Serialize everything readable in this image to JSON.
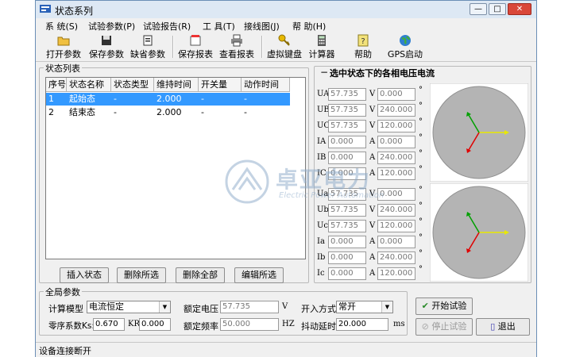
{
  "window": {
    "title": "状态系列",
    "minimize": "—",
    "maximize": "□",
    "close": "✕"
  },
  "menu": [
    "系 统(S)",
    "试验参数(P)",
    "试验报告(R)",
    "工 具(T)",
    "接线图(J)",
    "帮 助(H)"
  ],
  "toolbar": [
    {
      "label": "打开参数",
      "icon": "open-folder-icon"
    },
    {
      "label": "保存参数",
      "icon": "floppy-disk-icon"
    },
    {
      "label": "缺省参数",
      "icon": "default-doc-icon"
    },
    {
      "label": "保存报表",
      "icon": "save-report-icon"
    },
    {
      "label": "查看报表",
      "icon": "printer-icon"
    },
    {
      "label": "虚拟键盘",
      "icon": "key-icon"
    },
    {
      "label": "计算器",
      "icon": "calculator-icon"
    },
    {
      "label": "帮助",
      "icon": "help-icon"
    },
    {
      "label": "GPS启动",
      "icon": "globe-icon"
    }
  ],
  "state_list": {
    "title": "状态列表",
    "columns": [
      "序号",
      "状态名称",
      "状态类型",
      "维持时间",
      "开关量",
      "动作时间"
    ],
    "rows": [
      [
        "1",
        "起始态",
        "-",
        "2.000",
        "-",
        "-"
      ],
      [
        "2",
        "结束态",
        "-",
        "2.000",
        "-",
        "-"
      ]
    ],
    "buttons": [
      "插入状态",
      "删除所选",
      "删除全部",
      "编辑所选"
    ]
  },
  "phase_panel": {
    "title": "选中状态下的各相电压电流",
    "collapse_glyph": "−",
    "group1": [
      {
        "label": "UA",
        "mag": "57.735",
        "unit": "V",
        "angle": "0.000"
      },
      {
        "label": "UB",
        "mag": "57.735",
        "unit": "V",
        "angle": "240.000"
      },
      {
        "label": "UC",
        "mag": "57.735",
        "unit": "V",
        "angle": "120.000"
      },
      {
        "label": "IA",
        "mag": "0.000",
        "unit": "A",
        "angle": "0.000"
      },
      {
        "label": "IB",
        "mag": "0.000",
        "unit": "A",
        "angle": "240.000"
      },
      {
        "label": "IC",
        "mag": "0.000",
        "unit": "A",
        "angle": "120.000"
      }
    ],
    "group2": [
      {
        "label": "Ua",
        "mag": "57.735",
        "unit": "V",
        "angle": "0.000"
      },
      {
        "label": "Ub",
        "mag": "57.735",
        "unit": "V",
        "angle": "240.000"
      },
      {
        "label": "Uc",
        "mag": "57.735",
        "unit": "V",
        "angle": "120.000"
      },
      {
        "label": "Ia",
        "mag": "0.000",
        "unit": "A",
        "angle": "0.000"
      },
      {
        "label": "Ib",
        "mag": "0.000",
        "unit": "A",
        "angle": "240.000"
      },
      {
        "label": "Ic",
        "mag": "0.000",
        "unit": "A",
        "angle": "120.000"
      }
    ],
    "degree_symbol": "°"
  },
  "global": {
    "title": "全局参数",
    "calc_model_label": "计算模型",
    "calc_model_value": "电流恒定",
    "rated_voltage_label": "额定电压",
    "rated_voltage_value": "57.735",
    "rated_voltage_unit": "V",
    "input_mode_label": "开入方式",
    "input_mode_value": "常开",
    "zero_seq_label": "零序系数Ks:",
    "zero_seq_value": "0.670",
    "kr_label": "KR",
    "kr_value": "0.000",
    "rated_freq_label": "额定频率",
    "rated_freq_value": "50.000",
    "rated_freq_unit": "HZ",
    "debounce_label": "抖动延时",
    "debounce_value": "20.000",
    "debounce_unit": "ms"
  },
  "actions": {
    "start": "开始试验",
    "stop": "停止试验",
    "exit": "退出"
  },
  "status": "设备连接断开",
  "watermark": {
    "brand": "卓亚电力",
    "tagline": "Electric Power Automation"
  },
  "colors": {
    "voltage_a": "#e8e800",
    "voltage_b": "#e00000",
    "voltage_c": "#00a000",
    "selection": "#3399ff"
  }
}
